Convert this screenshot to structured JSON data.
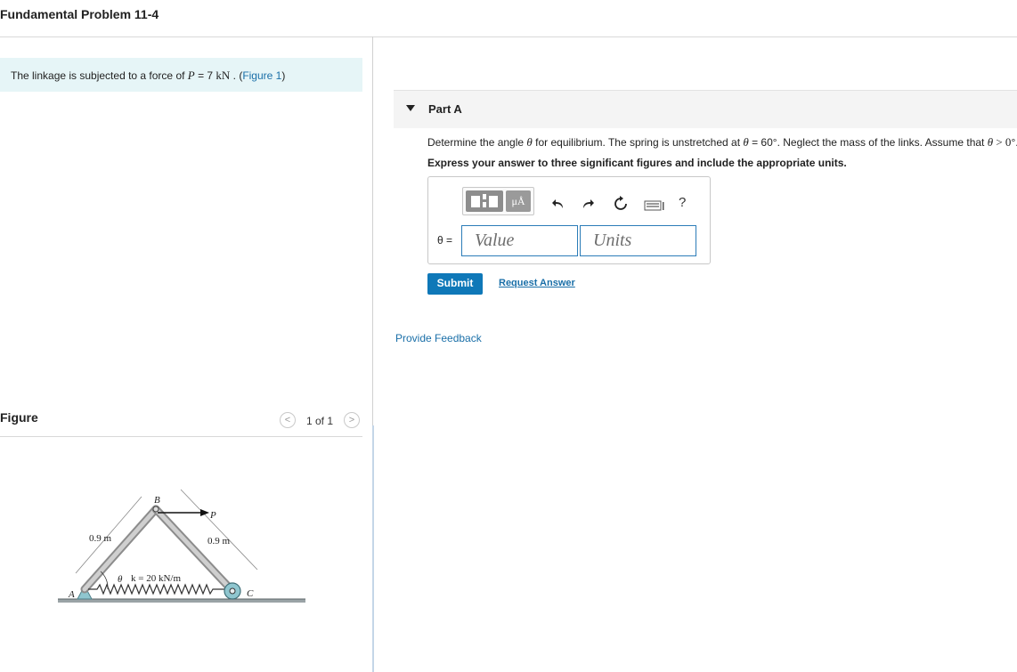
{
  "page": {
    "title": "Fundamental Problem 11-4"
  },
  "statement": {
    "prefix": "The linkage is subjected to a force of ",
    "var": "P",
    "eq": " = 7 ",
    "unit": "kN",
    "suffix": " . (",
    "link": "Figure 1",
    "close": ")"
  },
  "figure_panel": {
    "label": "Figure",
    "pager": {
      "text": "1 of 1",
      "prev": "<",
      "next": ">"
    },
    "diagram": {
      "label_b": "B",
      "label_p": "P",
      "label_a": "A",
      "label_c": "C",
      "label_theta": "θ",
      "left_length": "0.9 m",
      "right_length": "0.9 m",
      "spring": "k = 20 kN/m"
    }
  },
  "part_a": {
    "title": "Part A",
    "question": {
      "t1": "Determine the angle ",
      "theta": "θ",
      "t2": " for equilibrium. The spring is unstretched at ",
      "t3": " = 60",
      "deg": "°",
      "t4": ". Neglect the mass of the links. Assume that ",
      "t5": " > 0",
      "t6": "."
    },
    "instruction": "Express your answer to three significant figures and include the appropriate units.",
    "toolbar": {
      "units_symbol": "μÅ",
      "undo_icon": "undo-icon",
      "redo_icon": "redo-icon",
      "reset_icon": "reset-icon",
      "keyboard_icon": "keyboard-icon",
      "help": "?"
    },
    "answer_label": "θ =",
    "value_placeholder": "Value",
    "units_placeholder": "Units",
    "submit": "Submit",
    "request_answer": "Request Answer"
  },
  "feedback": "Provide Feedback",
  "colors": {
    "accent": "#0f78b8",
    "link": "#1a6fa8",
    "statement_bg": "#e6f5f7"
  }
}
